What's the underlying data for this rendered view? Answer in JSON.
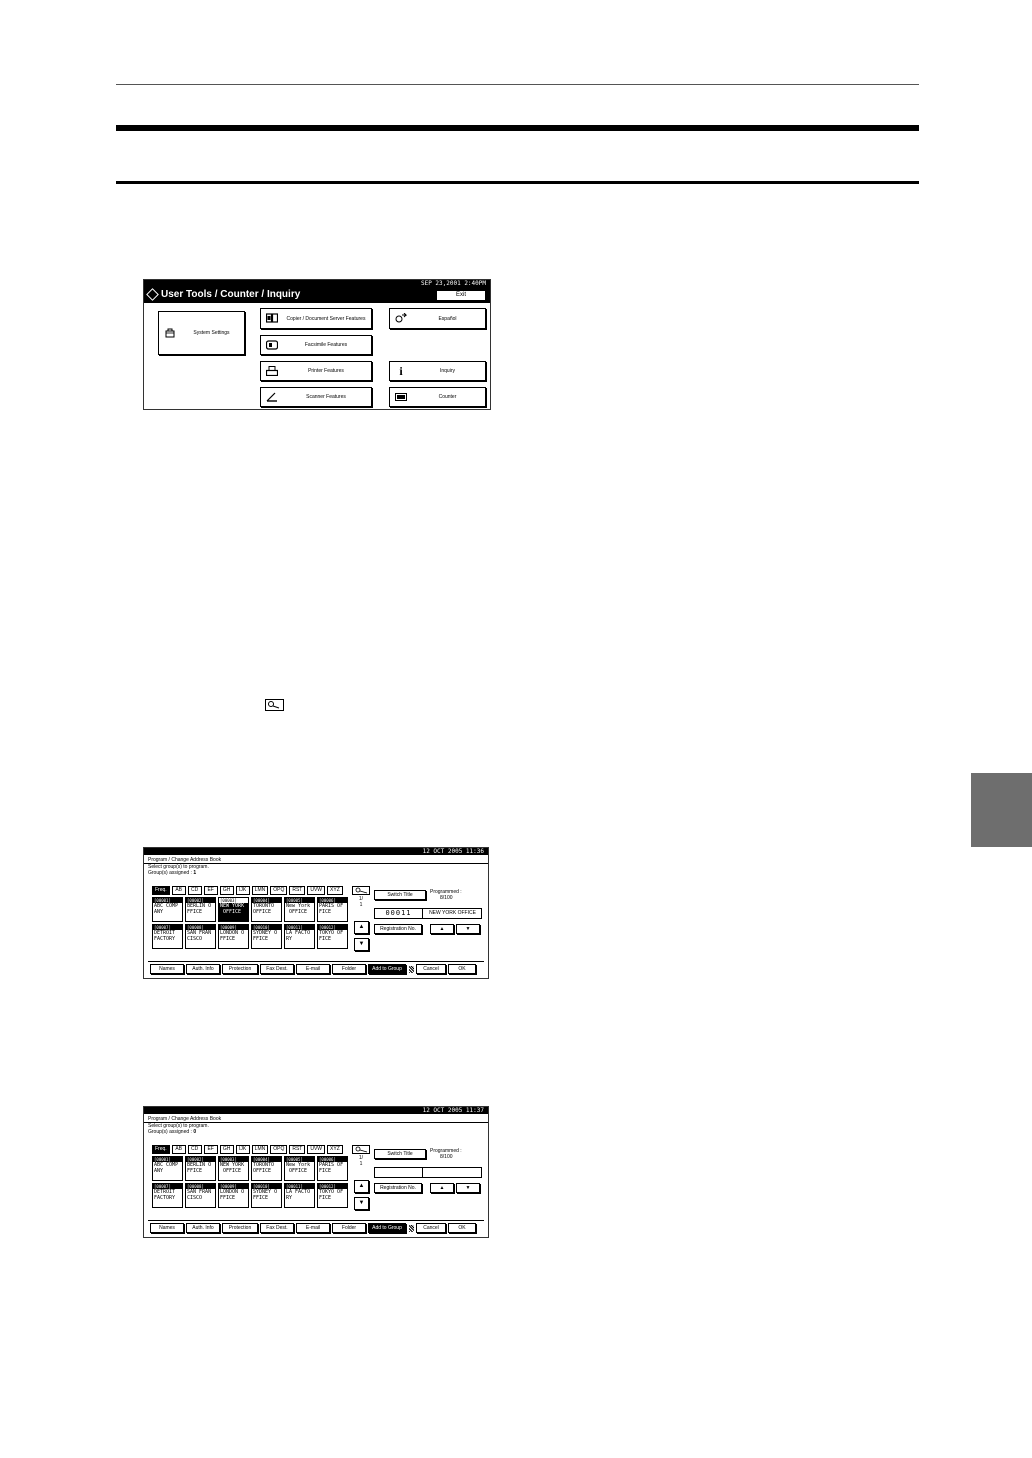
{
  "screen1": {
    "date": "SEP  23,2001  2:40PM",
    "title": "User Tools / Counter / Inquiry",
    "exit": "Exit",
    "buttons": {
      "system_settings": "System Settings",
      "copier": "Copier / Document Server Features",
      "facsimile": "Facsimile Features",
      "printer": "Printer Features",
      "scanner": "Scanner Features",
      "espanol": "Español",
      "inquiry": "Inquiry",
      "counter": "Counter"
    },
    "icons": {
      "system_settings": "toolbox-icon",
      "copier": "copier-icon",
      "facsimile": "fax-icon",
      "printer": "printer-icon",
      "scanner": "scanner-icon",
      "espanol": "language-icon",
      "inquiry": "info-icon",
      "counter": "counter-icon"
    }
  },
  "screen2": {
    "date": "12  OCT   2005 11:36",
    "panel_title": "Program / Change Address Book",
    "instruction": "Select group(s) to program.",
    "assigned_label": "Group(s) assigned :",
    "assigned_count": "1",
    "tabs": [
      "Freq.",
      "AB",
      "CD",
      "EF",
      "GH",
      "IJK",
      "LMN",
      "OPQ",
      "RST",
      "UVW",
      "XYZ"
    ],
    "entries": [
      {
        "num": "[00001]",
        "name": "ABC COMP\nANY",
        "selected": false
      },
      {
        "num": "[00002]",
        "name": "BERLIN O\nFFICE",
        "selected": false
      },
      {
        "num": "[00003]",
        "name": "NEW YORK\n OFFICE",
        "selected": true
      },
      {
        "num": "[00004]",
        "name": "TORONTO \nOFFICE",
        "selected": false
      },
      {
        "num": "[00005]",
        "name": "New York\n OFFICE",
        "selected": false
      },
      {
        "num": "[00006]",
        "name": "PARIS OF\nFICE",
        "selected": false
      },
      {
        "num": "[00007]",
        "name": "DETROIT \nFACTORY",
        "selected": false
      },
      {
        "num": "[00008]",
        "name": "SAN FRAN\nCISCO",
        "selected": false
      },
      {
        "num": "[00009]",
        "name": "LONDON O\nFFICE",
        "selected": false
      },
      {
        "num": "[00010]",
        "name": "SYDNEY O\nFFICE",
        "selected": false
      },
      {
        "num": "[00011]",
        "name": "LA FACTO\nRY",
        "selected": false
      },
      {
        "num": "[00012]",
        "name": "TOKYO OF\nFICE",
        "selected": false
      }
    ],
    "page": "1/",
    "page_total": "1",
    "switch_title": "Switch Title",
    "programmed_label": "Programmed :",
    "programmed_value": "8/100",
    "reg_number": "00011",
    "reg_name": "NEW YORK OFFICE",
    "registration_no": "Registration No.",
    "bottom": [
      "Names",
      "Auth. Info",
      "Protection",
      "Fax Dest.",
      "E-mail",
      "Folder",
      "Add to Group"
    ],
    "cancel": "Cancel",
    "ok": "OK"
  },
  "screen3": {
    "date": "12  OCT   2005 11:37",
    "panel_title": "Program / Change Address Book",
    "instruction": "Select group(s) to program.",
    "assigned_label": "Group(s) assigned :",
    "assigned_count": "0",
    "tabs": [
      "Freq.",
      "AB",
      "CD",
      "EF",
      "GH",
      "IJK",
      "LMN",
      "OPQ",
      "RST",
      "UVW",
      "XYZ"
    ],
    "entries": [
      {
        "num": "[00001]",
        "name": "ABC COMP\nANY",
        "selected": false
      },
      {
        "num": "[00002]",
        "name": "BERLIN O\nFFICE",
        "selected": false
      },
      {
        "num": "[00003]",
        "name": "NEW YORK\n OFFICE",
        "selected": false
      },
      {
        "num": "[00004]",
        "name": "TORONTO \nOFFICE",
        "selected": false
      },
      {
        "num": "[00005]",
        "name": "New York\n OFFICE",
        "selected": false
      },
      {
        "num": "[00006]",
        "name": "PARIS OF\nFICE",
        "selected": false
      },
      {
        "num": "[00007]",
        "name": "DETROIT \nFACTORY",
        "selected": false
      },
      {
        "num": "[00008]",
        "name": "SAN FRAN\nCISCO",
        "selected": false
      },
      {
        "num": "[00009]",
        "name": "LONDON O\nFFICE",
        "selected": false
      },
      {
        "num": "[00010]",
        "name": "SYDNEY O\nFFICE",
        "selected": false
      },
      {
        "num": "[00011]",
        "name": "LA FACTO\nRY",
        "selected": false
      },
      {
        "num": "[00012]",
        "name": "TOKYO OF\nFICE",
        "selected": false
      }
    ],
    "page": "1/",
    "page_total": "1",
    "switch_title": "Switch Title",
    "programmed_label": "Programmed :",
    "programmed_value": "8/100",
    "reg_number": "",
    "reg_name": "",
    "registration_no": "Registration No.",
    "bottom": [
      "Names",
      "Auth. Info",
      "Protection",
      "Fax Dest.",
      "E-mail",
      "Folder",
      "Add to Group"
    ],
    "cancel": "Cancel",
    "ok": "OK"
  },
  "inline_icon": "search-key-icon"
}
